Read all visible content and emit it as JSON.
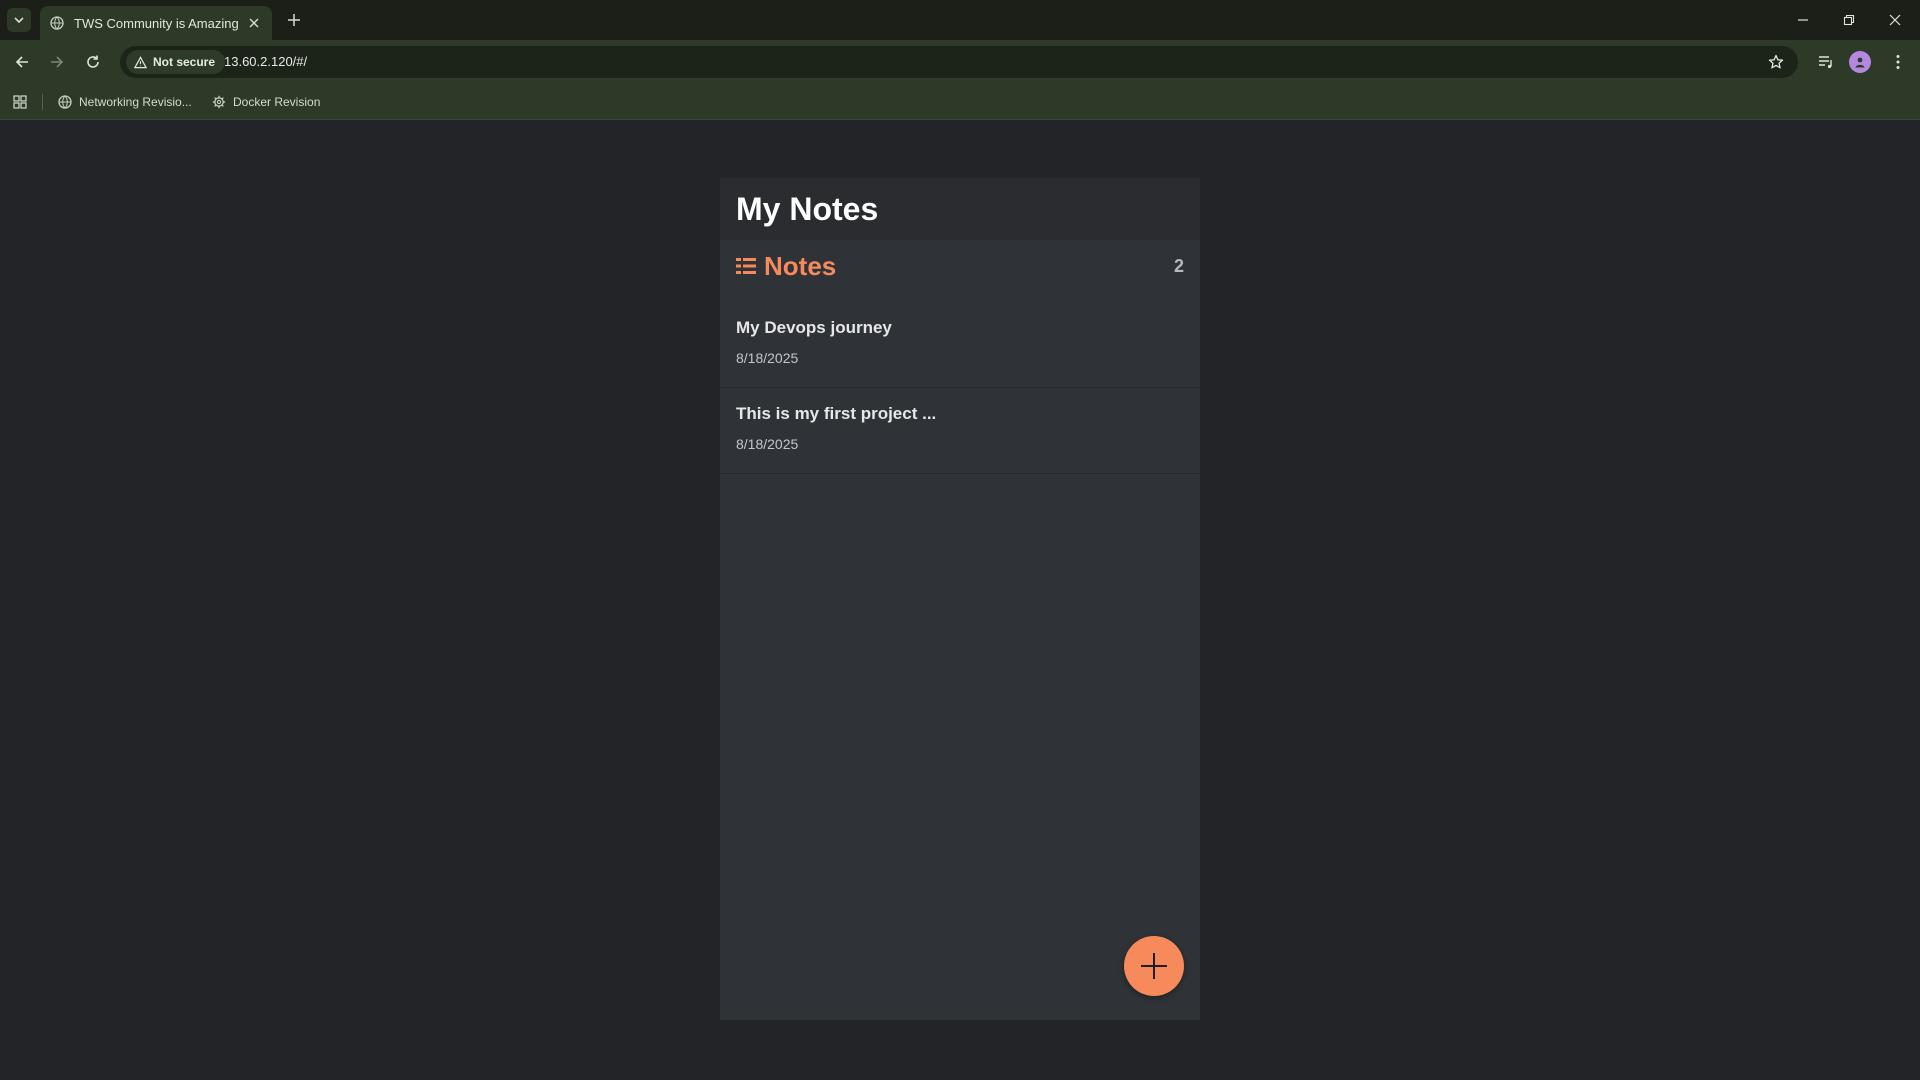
{
  "browser": {
    "tab": {
      "title": "TWS Community is Amazing"
    },
    "omnibox": {
      "security_label": "Not secure",
      "url": "13.60.2.120/#/"
    },
    "bookmarks": [
      {
        "label": "Networking Revisio..."
      },
      {
        "label": "Docker Revision"
      }
    ]
  },
  "app": {
    "title": "My Notes",
    "notes_header": {
      "label": "Notes",
      "count": "2"
    },
    "notes": [
      {
        "title": "My Devops journey",
        "date": "8/18/2025"
      },
      {
        "title": "This is my first project ...",
        "date": "8/18/2025"
      }
    ],
    "accent_color": "#f68a5b"
  },
  "icons": {
    "tab_search": "chevron-down-icon",
    "favicon": "globe-icon",
    "new_tab": "plus-icon",
    "fab": "plus-icon",
    "notes_list": "list-icon"
  }
}
